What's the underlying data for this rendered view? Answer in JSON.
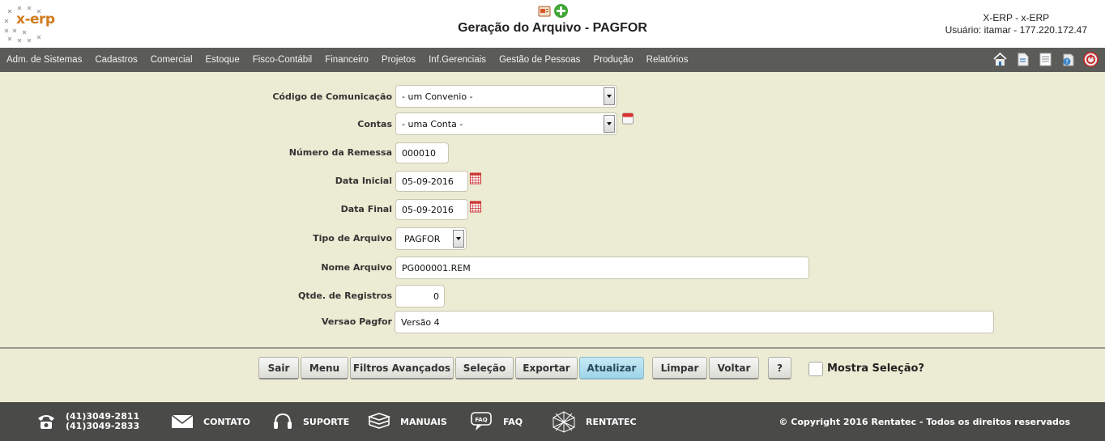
{
  "header": {
    "logo_text": "x-erp",
    "title": "Geração do Arquivo - PAGFOR",
    "system": "X-ERP - x-ERP",
    "user_line": "Usuário: itamar - 177.220.172.47"
  },
  "menu": {
    "items": [
      "Adm. de Sistemas",
      "Cadastros",
      "Comercial",
      "Estoque",
      "Fisco-Contábil",
      "Financeiro",
      "Projetos",
      "Inf.Gerenciais",
      "Gestão de Pessoas",
      "Produção",
      "Relatórios"
    ]
  },
  "form": {
    "codigo_label": "Código de Comunicação",
    "codigo_value": "- um Convenio -",
    "contas_label": "Contas",
    "contas_value": "- uma Conta -",
    "remessa_label": "Número da Remessa",
    "remessa_value": "000010",
    "data_inicial_label": "Data Inicial",
    "data_inicial_value": "05-09-2016",
    "data_final_label": "Data Final",
    "data_final_value": "05-09-2016",
    "tipo_label": "Tipo de Arquivo",
    "tipo_value": "PAGFOR",
    "nome_label": "Nome Arquivo",
    "nome_value": "PG000001.REM",
    "qtde_label": "Qtde. de Registros",
    "qtde_value": "0",
    "versao_label": "Versao Pagfor",
    "versao_value": "Versão 4"
  },
  "buttons": {
    "sair": "Sair",
    "menu": "Menu",
    "filtros": "Filtros Avançados",
    "selecao": "Seleção",
    "exportar": "Exportar",
    "atualizar": "Atualizar",
    "limpar": "Limpar",
    "voltar": "Voltar",
    "help": "?",
    "mostra_selecao": "Mostra Seleção?"
  },
  "footer": {
    "phone1": "(41)3049-2811",
    "phone2": "(41)3049-2833",
    "contato": "CONTATO",
    "suporte": "SUPORTE",
    "manuais": "MANUAIS",
    "faq": "FAQ",
    "faq_icon_text": "FAQ",
    "rentatec": "RENTATEC",
    "copyright": "© Copyright 2016 Rentatec - Todos os direitos reservados"
  },
  "colors": {
    "form_bg": "#ecebd3",
    "menubar_bg": "#5b5b58",
    "footer_bg": "#4a4a48",
    "active_button": "#a8dbec"
  }
}
